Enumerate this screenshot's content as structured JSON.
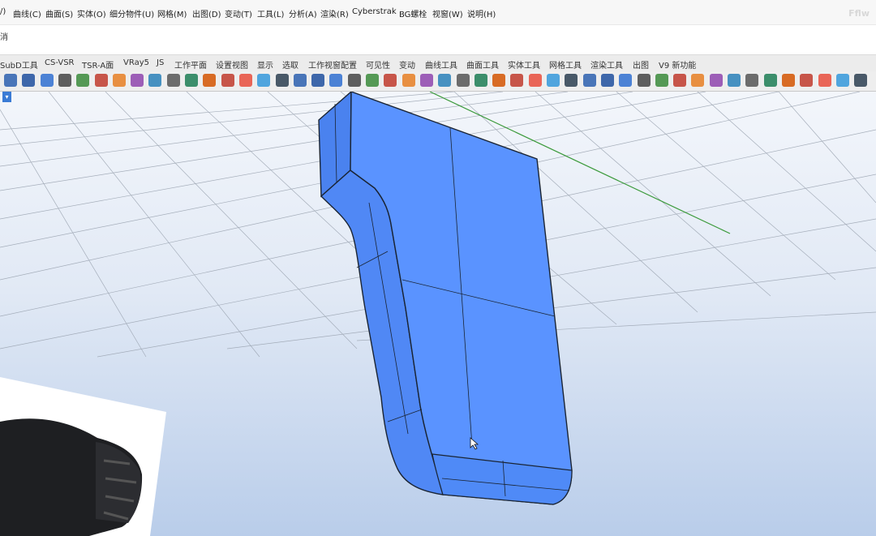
{
  "menu": {
    "items": [
      "/)",
      "曲线(C)",
      "曲面(S)",
      "实体(O)",
      "细分物件(U)",
      "网格(M)",
      "出图(D)",
      "变动(T)",
      "工具(L)",
      "分析(A)",
      "渲染(R)",
      "Cyberstrak",
      "BG螺栓",
      "视窗(W)",
      "说明(H)"
    ]
  },
  "watermark": "Fflw",
  "command": {
    "text": "消"
  },
  "tabs": [
    "SubD工具",
    "CS-VSR",
    "TSR-A面",
    "VRay5",
    "JS",
    "工作平面",
    "设置视图",
    "显示",
    "选取",
    "工作视窗配置",
    "可见性",
    "变动",
    "曲线工具",
    "曲面工具",
    "实体工具",
    "网格工具",
    "渲染工具",
    "出图",
    "V9 新功能"
  ],
  "toolbar_icons": [
    "solid-box-icon",
    "dome-icon",
    "car-shell-icon",
    "cube-icon",
    "texture-icon",
    "scissors-icon",
    "gradient-icon",
    "stack-icon",
    "paint-bucket-icon",
    "grid-pattern-icon",
    "matrix-icon",
    "frame-icon",
    "add-box-icon",
    "target-icon",
    "edit-surface-icon",
    "rotate-icon",
    "move-icon",
    "cylinder-icon",
    "loft-icon",
    "sketch-icon",
    "diamond-icon",
    "box-3d-icon",
    "phone-icon",
    "gumball-icon",
    "image-frame-icon",
    "crop-icon",
    "extrude-icon",
    "mesh-icon",
    "brush-icon",
    "curve-icon",
    "dots-ring-icon",
    "project-icon",
    "sphere-icon",
    "bomb-icon",
    "half-square-icon",
    "grid-cube-icon",
    "spiral-icon",
    "dashed-box-icon",
    "gold-cube-icon",
    "curve-edit-icon",
    "arc-icon",
    "walker-icon",
    "blue-cube-icon",
    "gear-a-icon",
    "gear-b-icon",
    "gear-c-icon",
    "export-icon",
    "frame-view-icon"
  ],
  "viewport": {
    "marker": "▾",
    "colors": {
      "model": "#5a93ff",
      "model_side": "#4a82ef",
      "edge": "#1a2433",
      "grid": "#9aa3b0",
      "axis_green": "#3b9a3b"
    }
  }
}
